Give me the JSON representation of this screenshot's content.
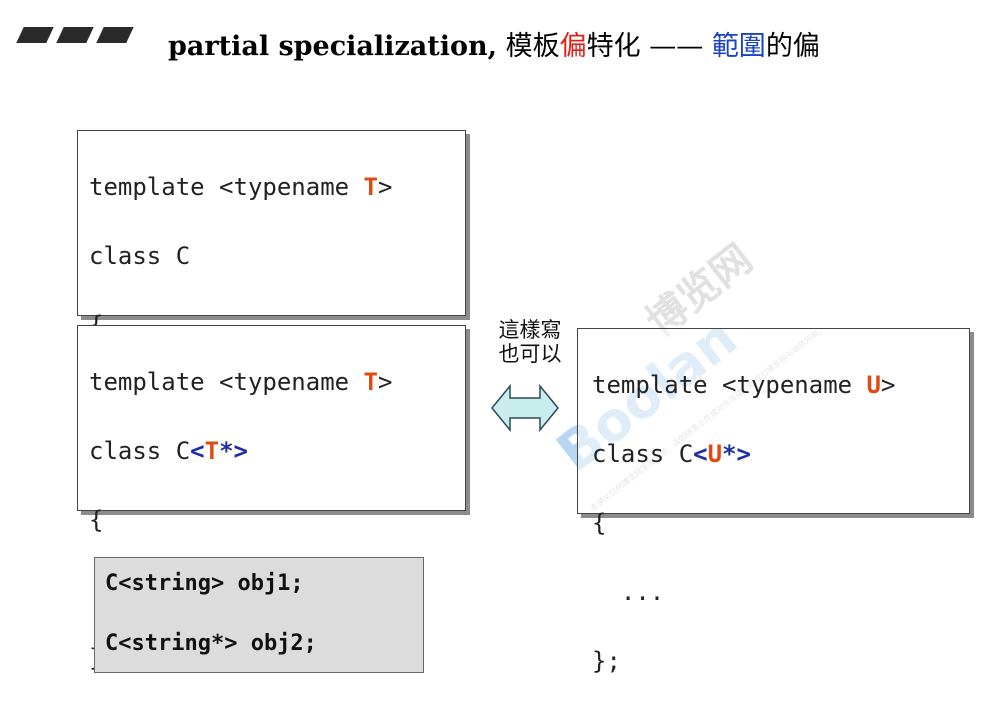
{
  "title": {
    "part_bold": "partial specialization,",
    "part_a": " 模板",
    "part_red": "偏",
    "part_b": "特化 —— ",
    "part_blue": "範圍",
    "part_c": "的偏"
  },
  "box1": {
    "line1_pre": "template <typename ",
    "line1_T": "T",
    "line1_post": ">",
    "line2": "class C",
    "line3": "{",
    "line4": "  ...",
    "line5": "};"
  },
  "box2": {
    "line1_pre": "template <typename ",
    "line1_T": "T",
    "line1_post": ">",
    "line2_pre": "class C",
    "line2_lt": "<",
    "line2_T": "T",
    "line2_rest": "*>",
    "line3": "{",
    "line4": "  ...",
    "line5": "};"
  },
  "box3": {
    "line1_pre": "template <typename ",
    "line1_U": "U",
    "line1_post": ">",
    "line2_pre": "class C",
    "line2_lt": "<",
    "line2_U": "U",
    "line2_rest": "*>",
    "line3": "{",
    "line4": "  ...",
    "line5": "};"
  },
  "note": {
    "line1": "這樣寫",
    "line2": "也可以"
  },
  "usage": {
    "line1": "C<string> obj1;",
    "line2": "C<string*> obj2;"
  },
  "watermark": {
    "brand_cn": "博览网",
    "brand_en": "Boolan",
    "small": "本讲义仅供博览网学员专用，请勿随意上传或对外传播，版权归博览网与讲师所有。"
  },
  "colors": {
    "red": "#e04a12",
    "blue": "#1f2fa8",
    "title_red": "#e0201a",
    "title_blue": "#1a44c8",
    "arrow_fill": "#c9ecec"
  },
  "icons": {
    "header_bars": "slanted-bars-icon",
    "arrow": "double-arrow-icon"
  }
}
